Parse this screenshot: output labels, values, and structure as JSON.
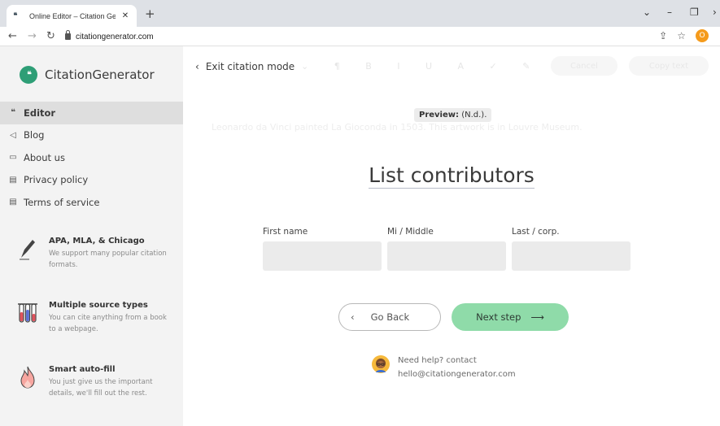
{
  "browser": {
    "tab_title": "Online Editor – Citation Generat",
    "tab_logo": "ₑₑ",
    "url": "citationgenerator.com",
    "profile_initial": "O"
  },
  "sidebar": {
    "brand": "CitationGenerator",
    "menu": [
      {
        "icon": "quote-icon",
        "glyph": "66",
        "label": "Editor",
        "active": true
      },
      {
        "icon": "megaphone-icon",
        "glyph": "◁",
        "label": "Blog",
        "active": false
      },
      {
        "icon": "id-card-icon",
        "glyph": "▭",
        "label": "About us",
        "active": false
      },
      {
        "icon": "document-icon",
        "glyph": "▤",
        "label": "Privacy policy",
        "active": false
      },
      {
        "icon": "document-icon",
        "glyph": "▤",
        "label": "Terms of service",
        "active": false
      }
    ],
    "features": [
      {
        "title": "APA, MLA, & Chicago",
        "text": "We support many popular citation formats."
      },
      {
        "title": "Multiple source types",
        "text": "You can cite anything from a book to a webpage."
      },
      {
        "title": "Smart auto-fill",
        "text": "You just give us the important details, we'll fill out the rest."
      }
    ]
  },
  "main": {
    "exit_label": "Exit citation mode",
    "preview_label": "Preview:",
    "preview_value": "(N.d.).",
    "faint_sentence": "Leonardo da Vinci painted La Gioconda in 1503. This artwork is in Louvre Museum.",
    "faint_buttons": [
      "Cancel",
      "Copy text"
    ],
    "heading": "List contributors",
    "fields": {
      "first_label": "First name",
      "middle_label": "Mi / Middle",
      "last_label": "Last / corp.",
      "first_value": "",
      "middle_value": "",
      "last_value": ""
    },
    "back_label": "Go Back",
    "next_label": "Next step",
    "help_line1": "Need help? contact",
    "help_line2": "hello@citationgenerator.com"
  },
  "colors": {
    "accent": "#2e9e76",
    "next_button": "#8fdba9",
    "sidebar_bg": "#f3f3f3",
    "profile": "#f59b1c"
  }
}
